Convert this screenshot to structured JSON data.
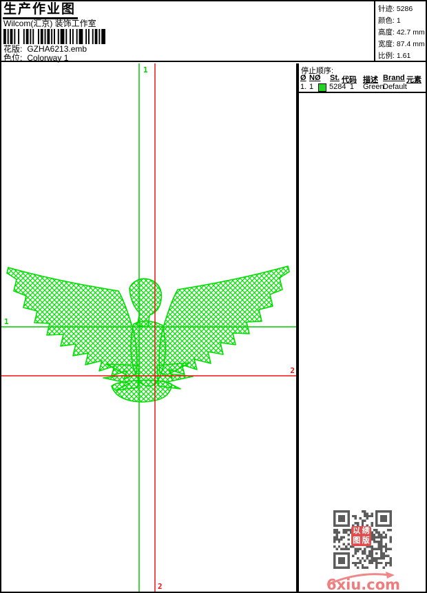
{
  "header": {
    "title": "生产作业图",
    "subtitle": "Wilcom(汇京) 装饰工作室",
    "pattern_label": "花版:",
    "pattern_value": "GZHA6213.emb",
    "colorway_label": "色位:",
    "colorway_value": "Colorway 1"
  },
  "stats": [
    {
      "label": "针迹:",
      "value": "5286"
    },
    {
      "label": "颜色:",
      "value": "1"
    },
    {
      "label": "高度:",
      "value": "42.7 mm"
    },
    {
      "label": "宽度:",
      "value": "87.4 mm"
    },
    {
      "label": "比例:",
      "value": "1.61"
    }
  ],
  "stop_sequence": {
    "title": "停止顺序:",
    "columns": [
      "Ø",
      "NØ",
      "St.",
      "代码",
      "描述",
      "Brand",
      "元素"
    ],
    "rows": [
      {
        "order": "1.",
        "needle": "1",
        "swatch_color": "#22d422",
        "stitches": "5284",
        "code": "1",
        "description": "Green",
        "brand": "Default",
        "elements": ""
      }
    ]
  },
  "canvas": {
    "start_marker": "1",
    "end_marker": "2",
    "colors": {
      "stitch": "#00dd00",
      "start_line": "#00cc00",
      "end_line": "#ee1111"
    }
  },
  "watermark": {
    "site": "6xiu.com",
    "color": "#ef7c7c",
    "seal_color": "#dd4f4f",
    "seal_chars": [
      "以",
      "绣",
      "图",
      "版"
    ],
    "qr_color": "#5c5c5c"
  }
}
